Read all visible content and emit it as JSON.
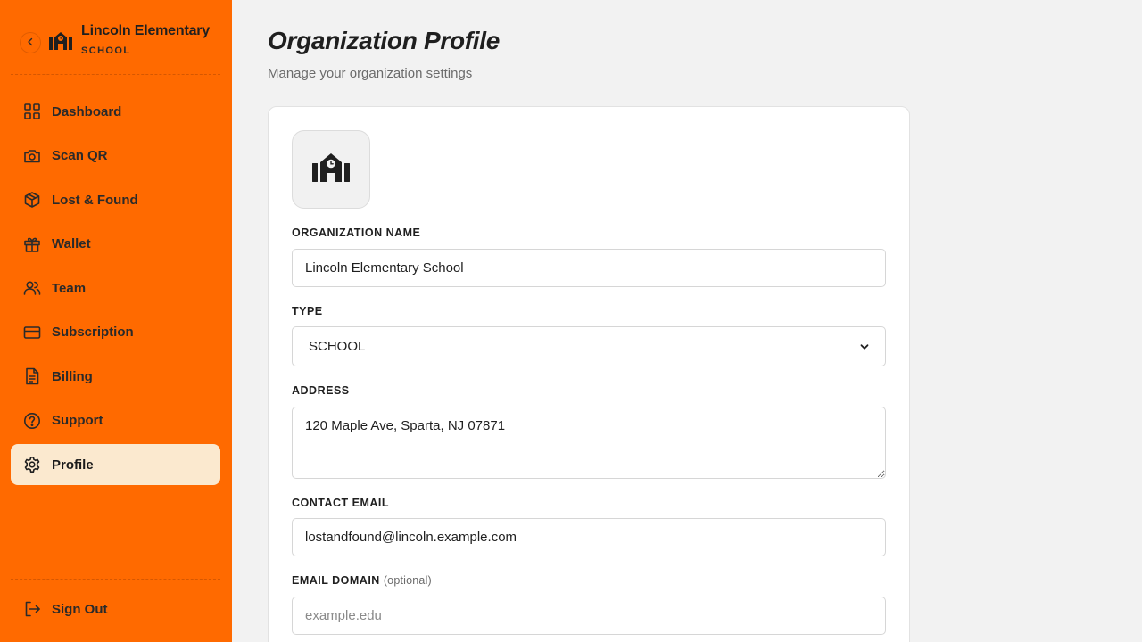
{
  "sidebar": {
    "org_name": "Lincoln Elementary School",
    "org_type": "SCHOOL",
    "back_icon": "chevron-left-icon",
    "logo_icon": "school-icon",
    "items": [
      {
        "label": "Dashboard",
        "icon": "grid-icon",
        "active": false
      },
      {
        "label": "Scan QR",
        "icon": "camera-icon",
        "active": false
      },
      {
        "label": "Lost & Found",
        "icon": "box-icon",
        "active": false
      },
      {
        "label": "Wallet",
        "icon": "gift-icon",
        "active": false
      },
      {
        "label": "Team",
        "icon": "users-icon",
        "active": false
      },
      {
        "label": "Subscription",
        "icon": "credit-card-icon",
        "active": false
      },
      {
        "label": "Billing",
        "icon": "document-icon",
        "active": false
      },
      {
        "label": "Support",
        "icon": "help-circle-icon",
        "active": false
      },
      {
        "label": "Profile",
        "icon": "gear-icon",
        "active": true
      }
    ],
    "signout_label": "Sign Out",
    "signout_icon": "log-out-icon"
  },
  "main": {
    "title": "Organization Profile",
    "subtitle": "Manage your organization settings"
  },
  "form": {
    "logo_icon": "school-icon",
    "org_name_label": "ORGANIZATION NAME",
    "org_name_value": "Lincoln Elementary School",
    "type_label": "TYPE",
    "type_value": "SCHOOL",
    "address_label": "ADDRESS",
    "address_value": "120 Maple Ave, Sparta, NJ 07871",
    "email_label": "CONTACT EMAIL",
    "email_value": "lostandfound@lincoln.example.com",
    "domain_label": "EMAIL DOMAIN",
    "domain_optional": "(optional)",
    "domain_placeholder": "example.edu"
  },
  "colors": {
    "sidebar_bg": "#ff6a00",
    "active_item_bg": "#fbe9cf",
    "page_bg": "#f2f2f2",
    "text": "#1f1f1f"
  }
}
